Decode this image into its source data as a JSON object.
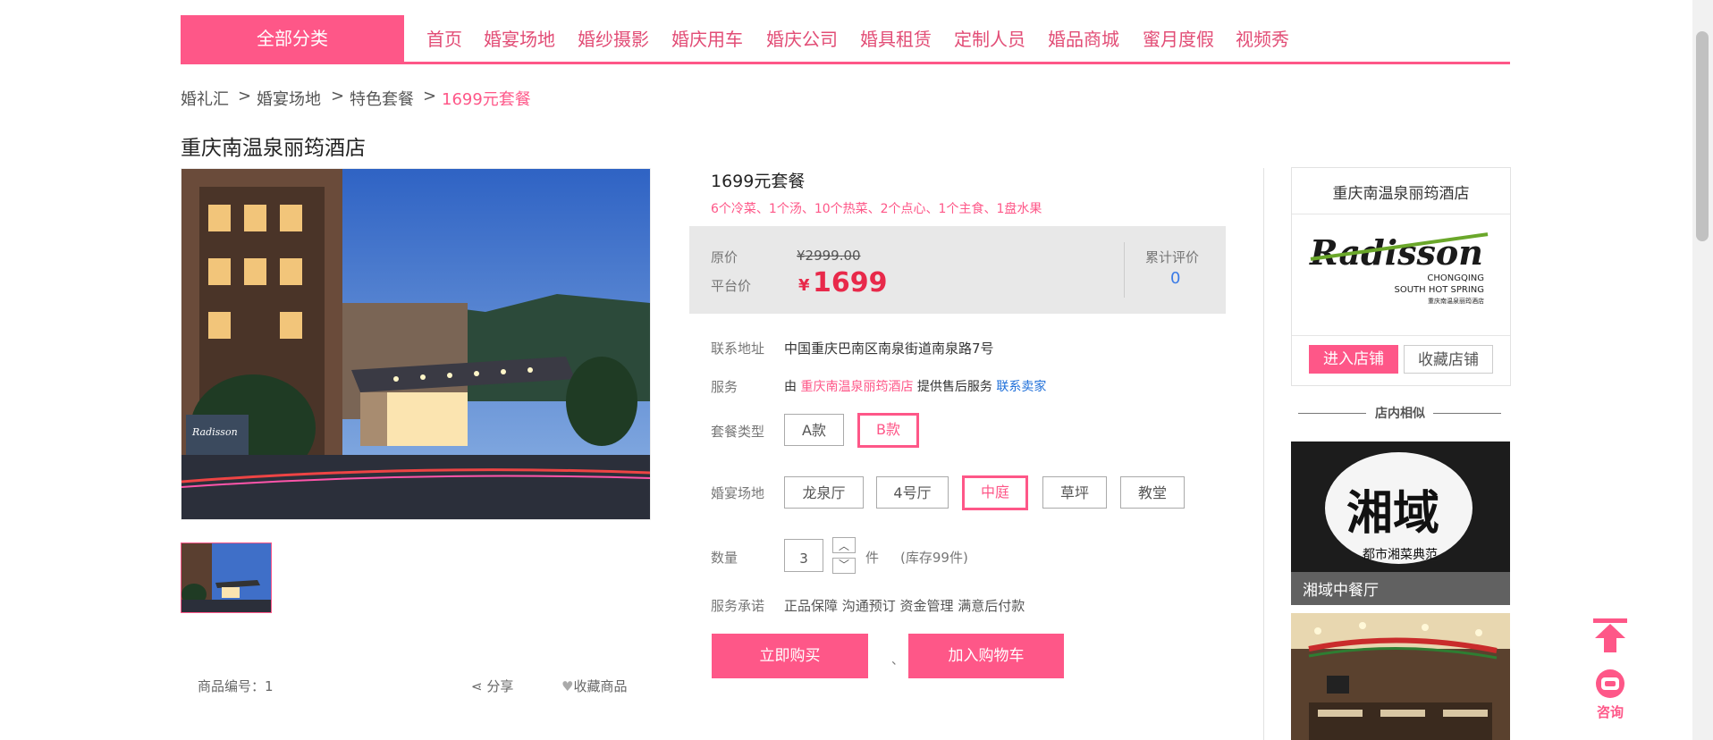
{
  "nav": {
    "all_categories": "全部分类",
    "items": [
      "首页",
      "婚宴场地",
      "婚纱摄影",
      "婚庆用车",
      "婚庆公司",
      "婚具租赁",
      "定制人员",
      "婚品商城",
      "蜜月度假",
      "视频秀"
    ]
  },
  "breadcrumb": {
    "items": [
      "婚礼汇",
      "婚宴场地",
      "特色套餐",
      "1699元套餐"
    ],
    "separator": ">"
  },
  "store_title": "重庆南温泉丽筠酒店",
  "product": {
    "name": "1699元套餐",
    "description": "6个冷菜、1个汤、10个热菜、2个点心、1个主食、1盘水果",
    "original_price_label": "原价",
    "original_price": "¥2999.00",
    "platform_price_label": "平台价",
    "currency": "¥",
    "platform_price": "1699",
    "reviews_label": "累计评价",
    "reviews_count": "0",
    "address_label": "联系地址",
    "address": "中国重庆巴南区南泉街道南泉路7号",
    "service_label": "服务",
    "service_prefix": "由",
    "service_shop": "重庆南温泉丽筠酒店",
    "service_suffix": "提供售后服务",
    "contact_seller": "联系卖家",
    "type_label": "套餐类型",
    "types": [
      "A款",
      "B款"
    ],
    "selected_type": "B款",
    "venue_label": "婚宴场地",
    "venues": [
      "龙泉厅",
      "4号厅",
      "中庭",
      "草坪",
      "教堂"
    ],
    "selected_venue": "中庭",
    "qty_label": "数量",
    "qty": "3",
    "qty_unit": "件",
    "stock": "(库存99件)",
    "promise_label": "服务承诺",
    "promises": "正品保障 沟通预订 资金管理 满意后付款",
    "buy_now": "立即购买",
    "separator": "、",
    "add_cart": "加入购物车",
    "sku_label": "商品编号：1",
    "share": "分享",
    "favorite": "收藏商品"
  },
  "sidebar": {
    "shop_name": "重庆南温泉丽筠酒店",
    "logo_text": "Radisson",
    "logo_sub1": "CHONGQING",
    "logo_sub2": "SOUTH HOT SPRING",
    "logo_sub3": "重庆南温泉丽筠酒店",
    "enter_shop": "进入店铺",
    "fav_shop": "收藏店铺",
    "similar_title": "店内相似",
    "similar": [
      {
        "name": "湘域中餐厅",
        "sign_big": "湘域",
        "sign_small": "都市湘菜典范"
      }
    ]
  },
  "float_widgets": {
    "consult": "咨询"
  },
  "colors": {
    "accent": "#fe5788",
    "price": "#e8294a",
    "link": "#1e6fd9"
  }
}
